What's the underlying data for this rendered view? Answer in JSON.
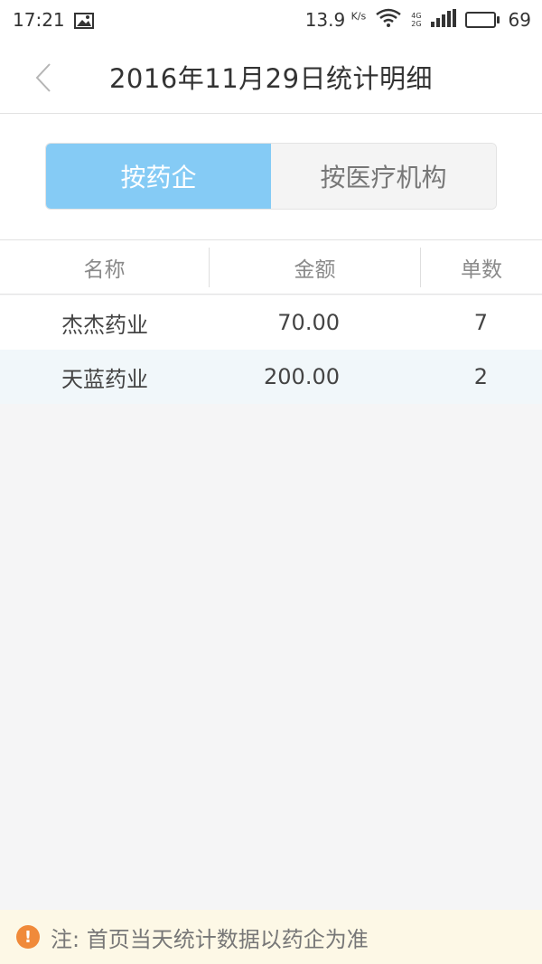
{
  "status_bar": {
    "time": "17:21",
    "speed": "13.9",
    "speed_unit": "K/s",
    "net_4g": "4G",
    "net_2g": "2G",
    "battery": "69",
    "battery_level": 0.69
  },
  "nav": {
    "title": "2016年11月29日统计明细"
  },
  "tabs": [
    {
      "label": "按药企",
      "active": true
    },
    {
      "label": "按医疗机构",
      "active": false
    }
  ],
  "table": {
    "headers": [
      "名称",
      "金额",
      "单数"
    ],
    "rows": [
      {
        "name": "杰杰药业",
        "amount": "70.00",
        "count": "7"
      },
      {
        "name": "天蓝药业",
        "amount": "200.00",
        "count": "2"
      }
    ]
  },
  "footer": {
    "note": "注: 首页当天统计数据以药企为准"
  },
  "colors": {
    "accent": "#85cbf5",
    "warning": "#f08a3a"
  }
}
